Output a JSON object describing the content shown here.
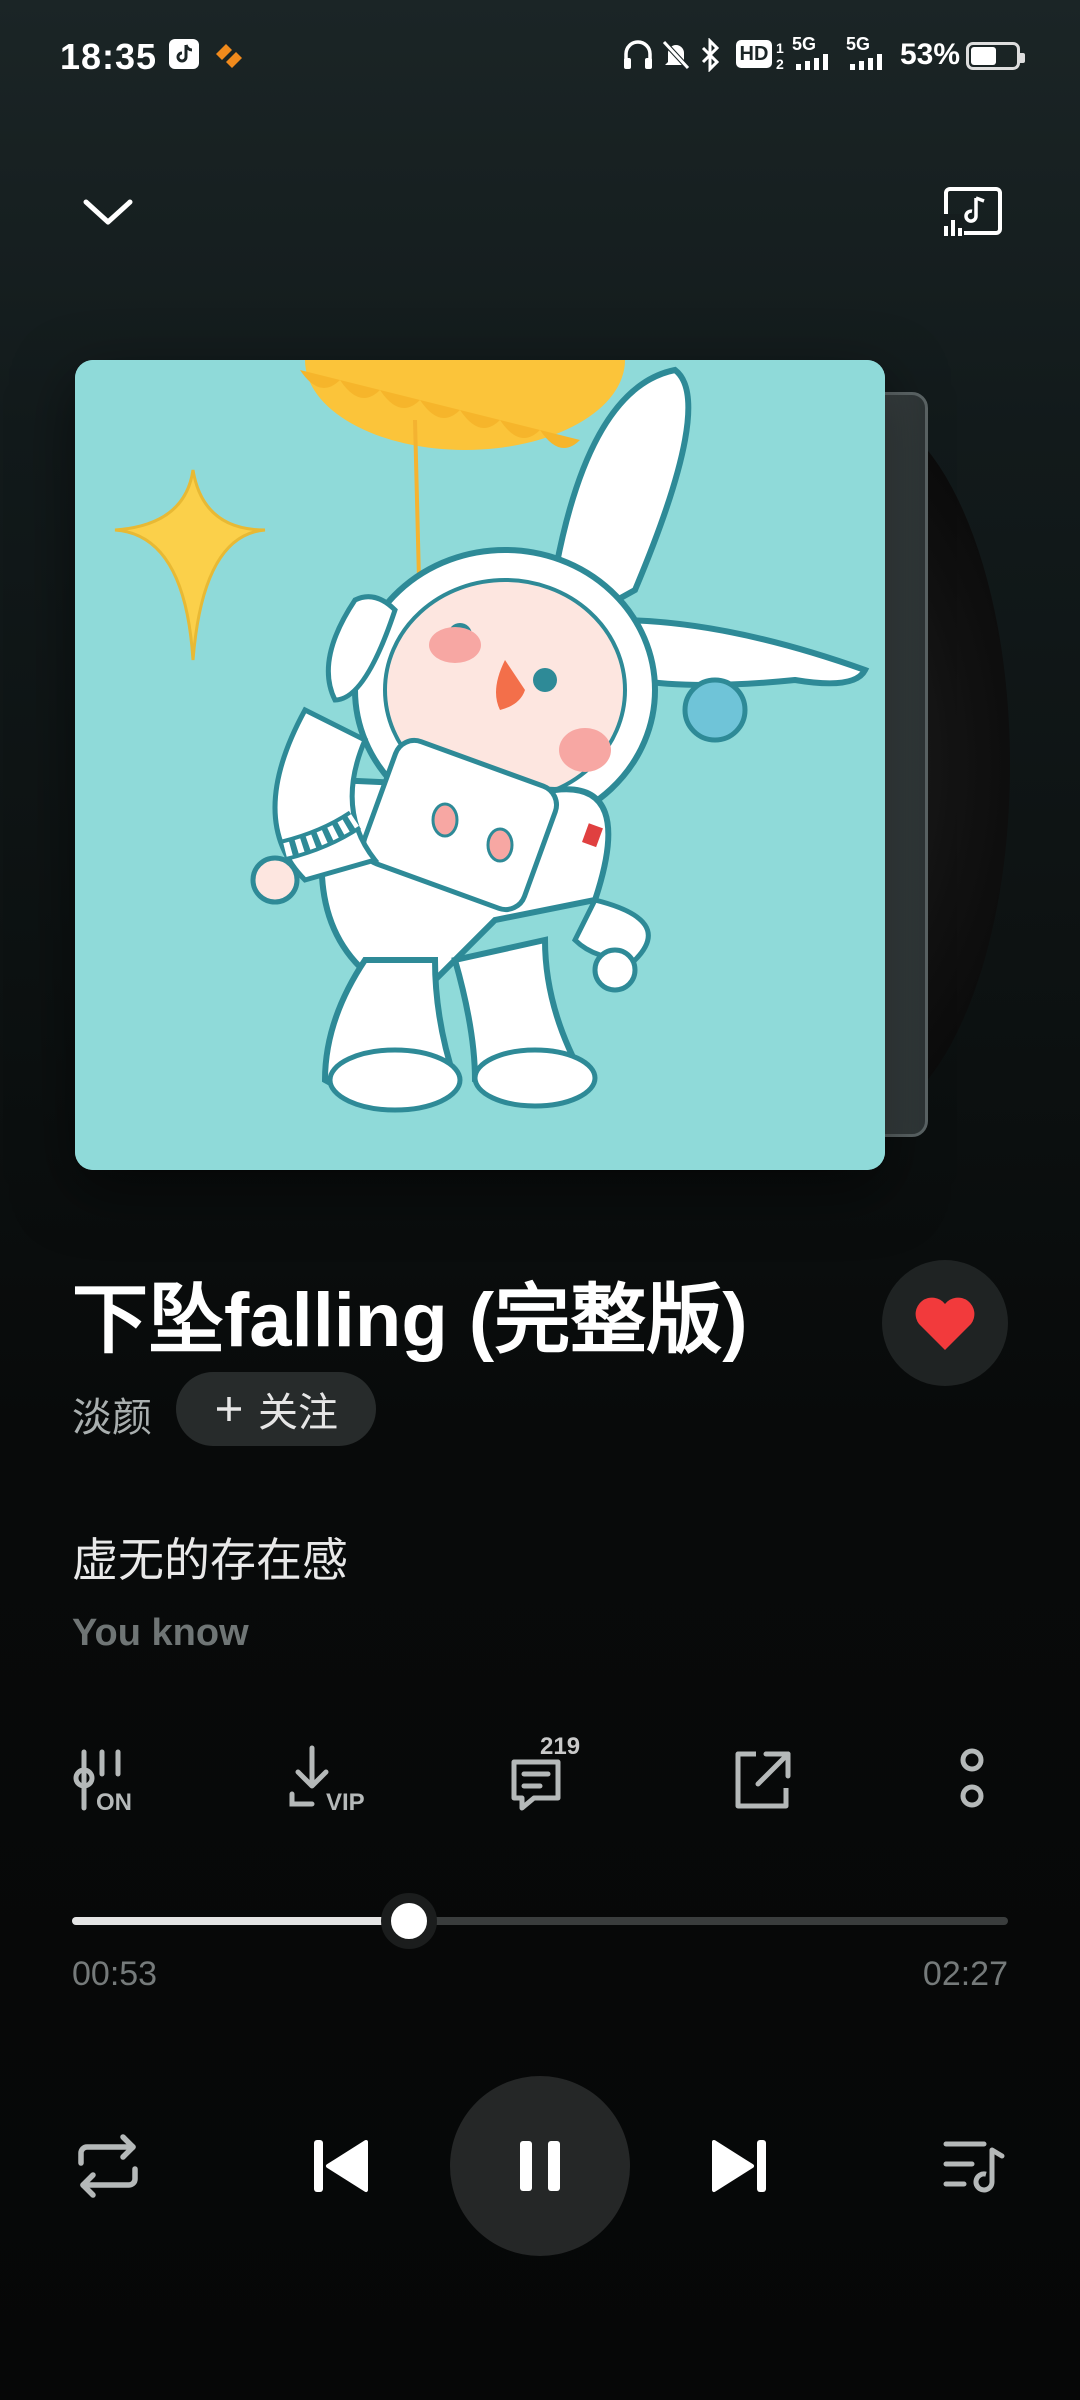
{
  "status_bar": {
    "time": "18:35",
    "battery_percent": "53%",
    "battery_level": 0.53,
    "icons": [
      "tiktok-icon",
      "app-notification-icon",
      "headphones-icon",
      "mute-icon",
      "bluetooth-icon",
      "hd-icon",
      "signal-5g-icon",
      "signal-5g-icon",
      "battery-icon"
    ],
    "hd_label": "HD",
    "net1": "5G",
    "net2": "5G"
  },
  "header": {
    "collapse_icon": "chevron-down-icon",
    "cast_icon": "music-cast-icon"
  },
  "song": {
    "title": "下坠falling (完整版)",
    "artist": "淡颜",
    "follow_label": "关注",
    "liked": true,
    "like_color": "#f23a3c"
  },
  "lyrics": {
    "current": "虚无的存在感",
    "next": "You know"
  },
  "actions": {
    "sound_effect_label": "ON",
    "download_label": "VIP",
    "comment_count": "219"
  },
  "progress": {
    "current": "00:53",
    "total": "02:27",
    "fraction": 0.36
  },
  "colors": {
    "accent_like": "#f23a3c",
    "album_bg": "#8fdad9"
  }
}
